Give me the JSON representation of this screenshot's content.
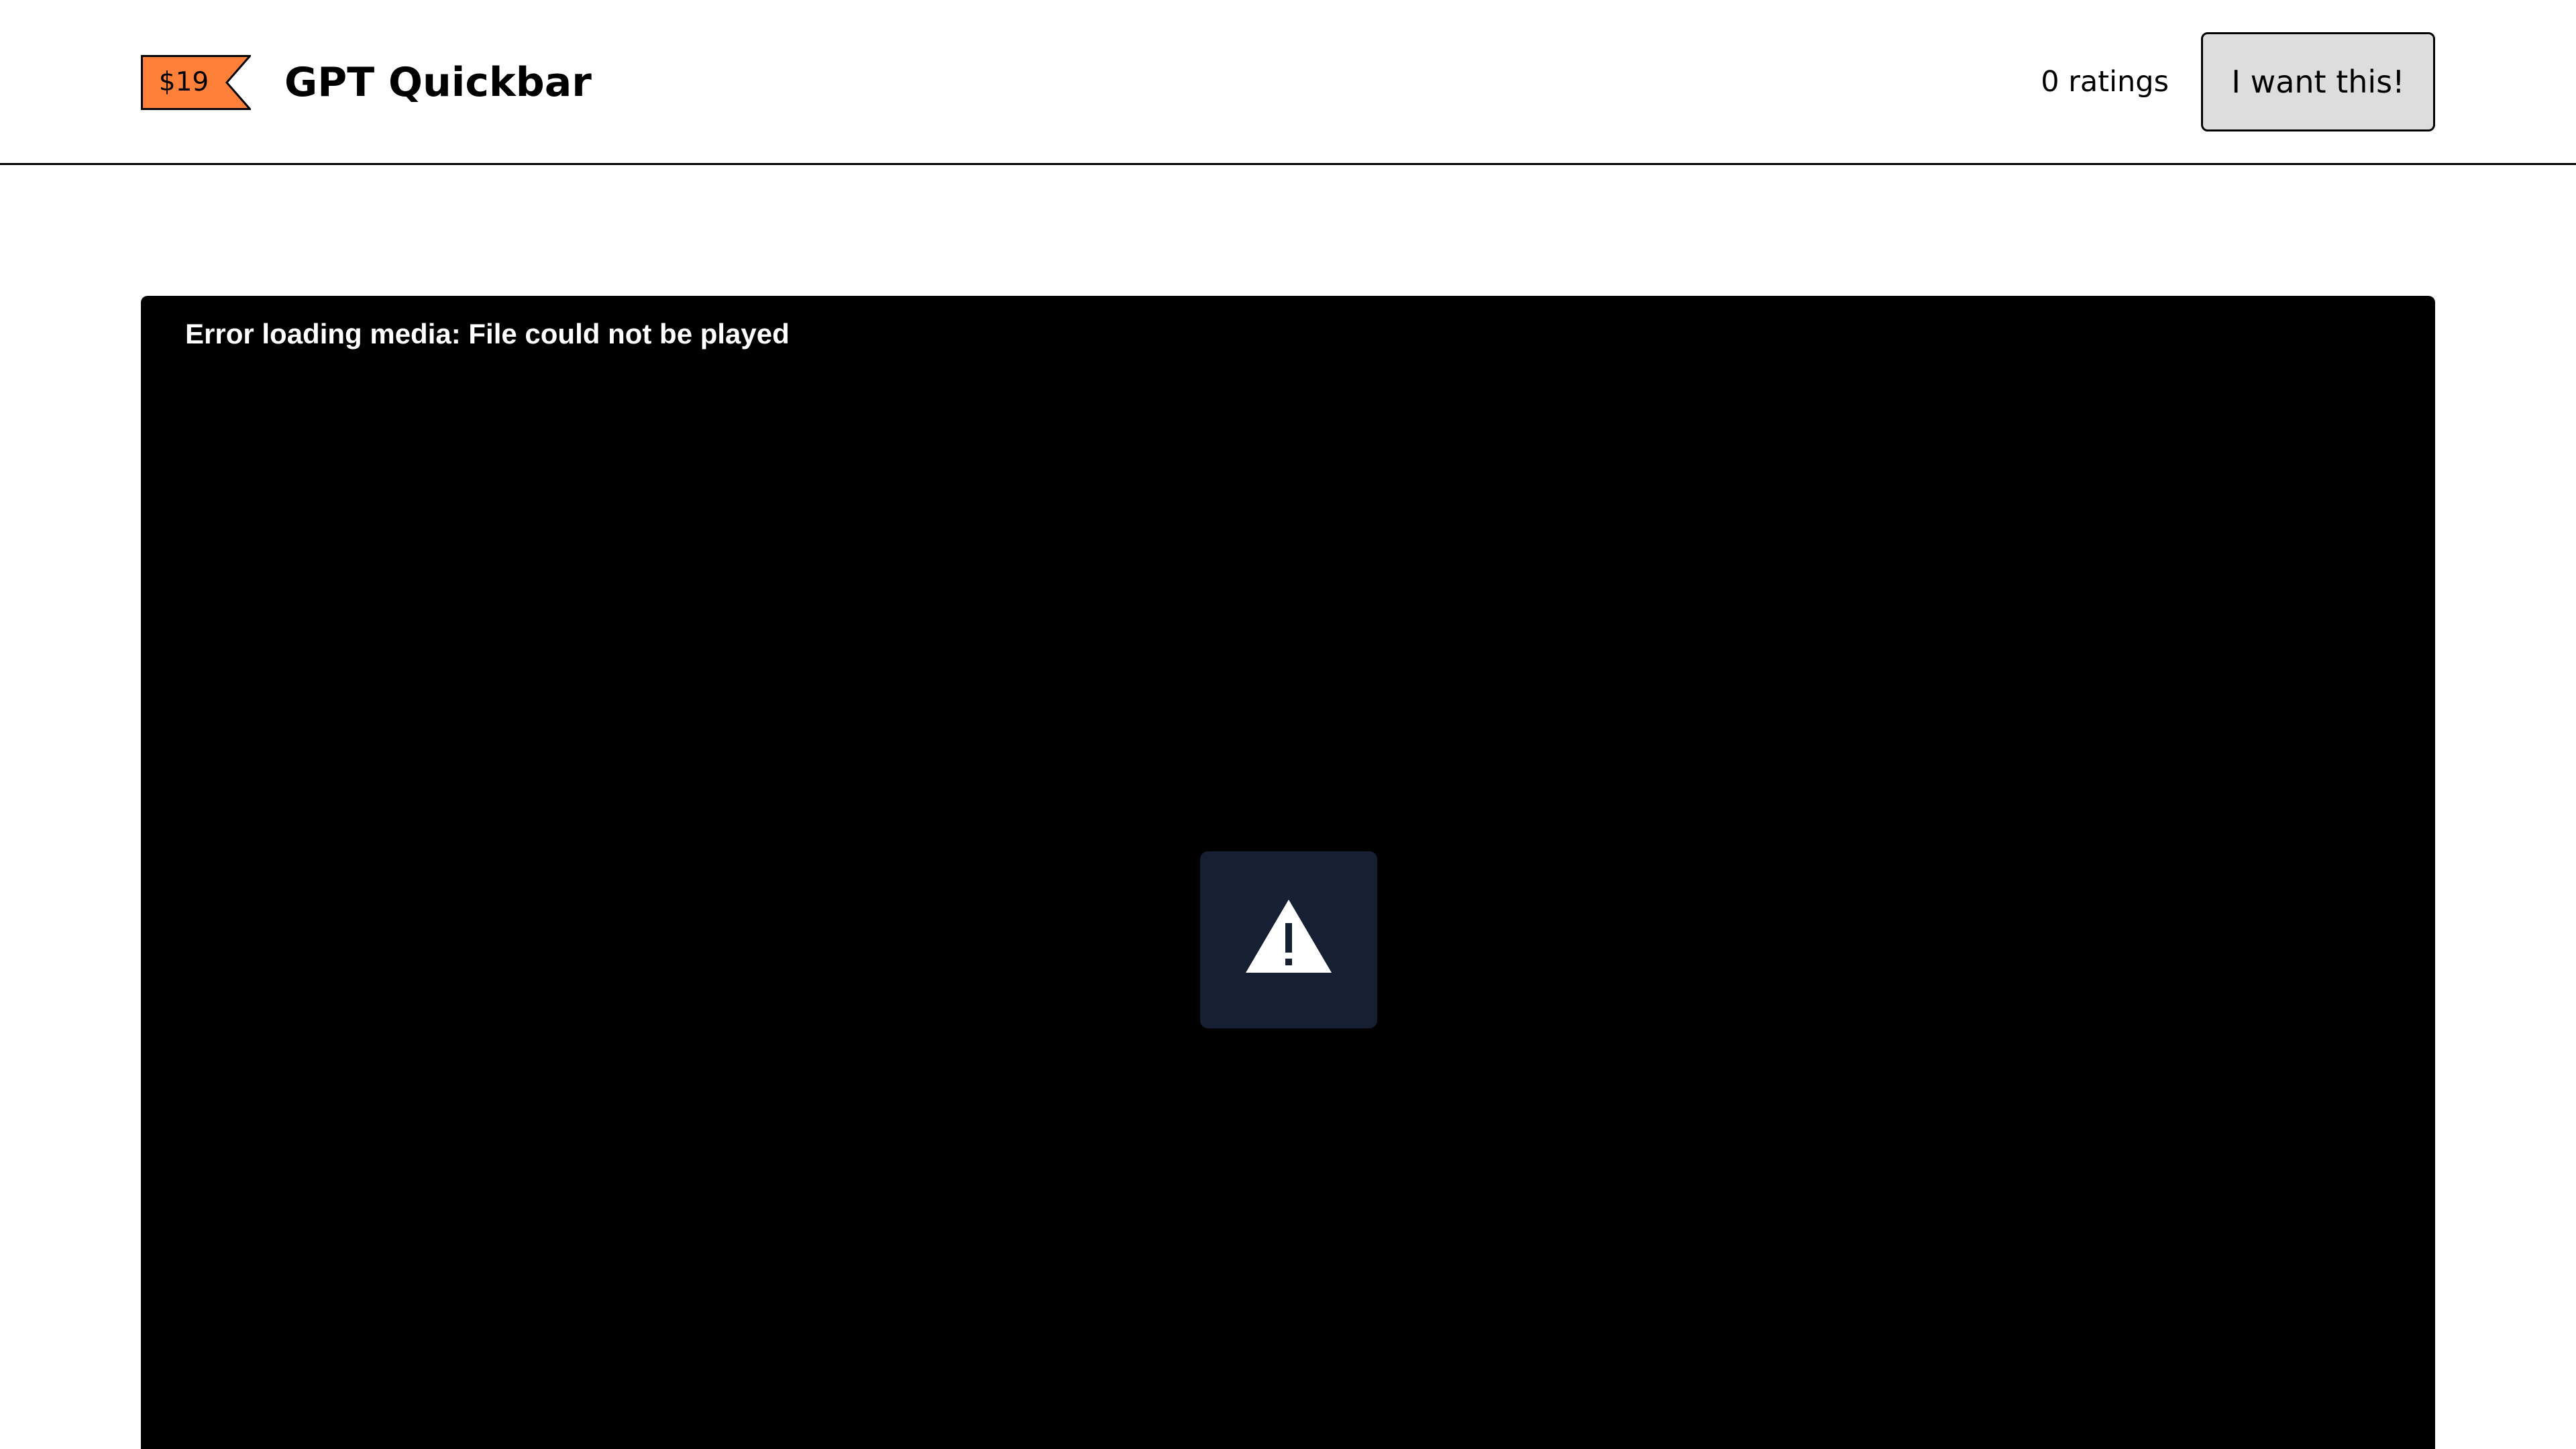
{
  "header": {
    "price": "$19",
    "product_title": "GPT Quickbar",
    "ratings_text": "0 ratings",
    "cta_label": "I want this!"
  },
  "media": {
    "error_message": "Error loading media: File could not be played"
  },
  "icons": {
    "price_tag": "price-tag-icon",
    "error": "warning-triangle-icon"
  },
  "colors": {
    "price_tag_fill": "#ff8038",
    "button_bg": "#dddddd",
    "player_bg": "#000000",
    "error_box_bg": "#162032",
    "text": "#000000",
    "inverse_text": "#ffffff"
  }
}
